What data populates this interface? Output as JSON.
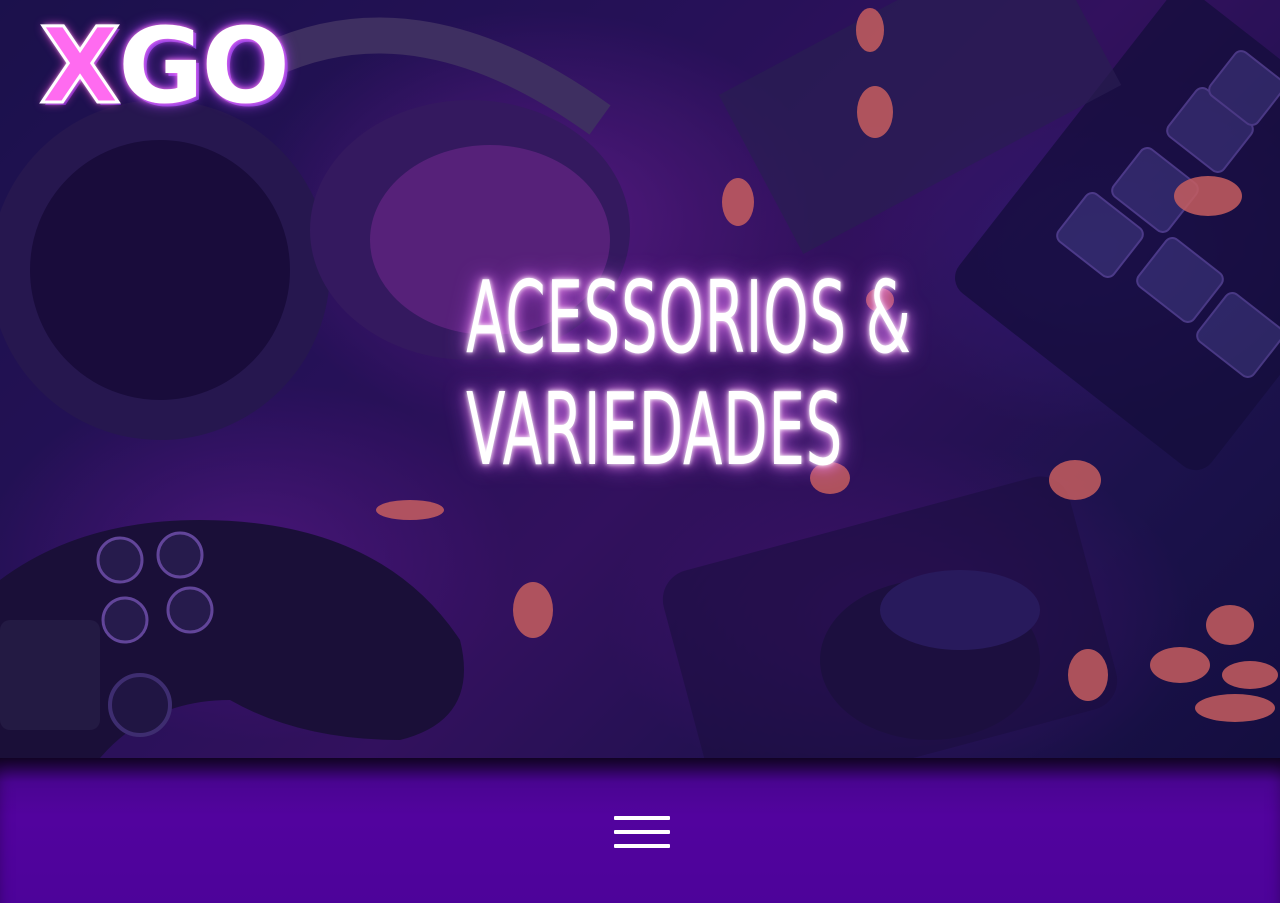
{
  "brand": {
    "logo_x": "X",
    "logo_go": "GO"
  },
  "hero": {
    "headline_line1": "ACESSORIOS &",
    "headline_line2": "VARIEDADES",
    "background_image": "gaming-accessories-photo"
  },
  "navbar": {
    "menu_icon": "hamburger-menu-icon",
    "background_color": "#4f039c"
  },
  "colors": {
    "accent_pink": "#ff6bf0",
    "glow_purple": "#d060ff",
    "text_white": "#ffffff"
  }
}
